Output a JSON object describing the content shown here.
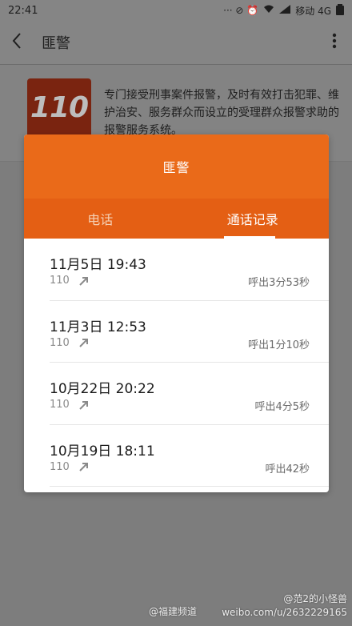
{
  "status_bar": {
    "time": "22:41",
    "indicators": "··· ⊘ ⏰ ",
    "carrier": "移动 4G",
    "icons": [
      "dots-icon",
      "no-disturb-icon",
      "alarm-icon",
      "wifi-icon",
      "signal-icon",
      "battery-icon"
    ]
  },
  "header": {
    "title": "匪警",
    "back_icon": "back-arrow-icon",
    "more_icon": "more-vertical-icon"
  },
  "info": {
    "logo_text": "110",
    "description": "专门接受刑事案件报警，及时有效打击犯罪、维护治安、服务群众而设立的受理群众报警求助的报警服务系统。"
  },
  "dialog": {
    "title": "匪警",
    "tabs": [
      {
        "label": "电话",
        "active": false
      },
      {
        "label": "通话记录",
        "active": true
      }
    ],
    "records": [
      {
        "time": "11月5日 19:43",
        "number": "110",
        "direction": "outgoing-call-icon",
        "duration": "呼出3分53秒"
      },
      {
        "time": "11月3日 12:53",
        "number": "110",
        "direction": "outgoing-call-icon",
        "duration": "呼出1分10秒"
      },
      {
        "time": "10月22日 20:22",
        "number": "110",
        "direction": "outgoing-call-icon",
        "duration": "呼出4分5秒"
      },
      {
        "time": "10月19日 18:11",
        "number": "110",
        "direction": "outgoing-call-icon",
        "duration": "呼出42秒"
      }
    ]
  },
  "watermark": {
    "channel": "@福建频道",
    "weibo_url": "weibo.com/u/2632229165",
    "weibo_user": "@范2的小怪兽"
  },
  "colors": {
    "accent": "#ea6a19",
    "tab_bar": "#e45f14",
    "overlay_background": "#7d7d7d"
  }
}
